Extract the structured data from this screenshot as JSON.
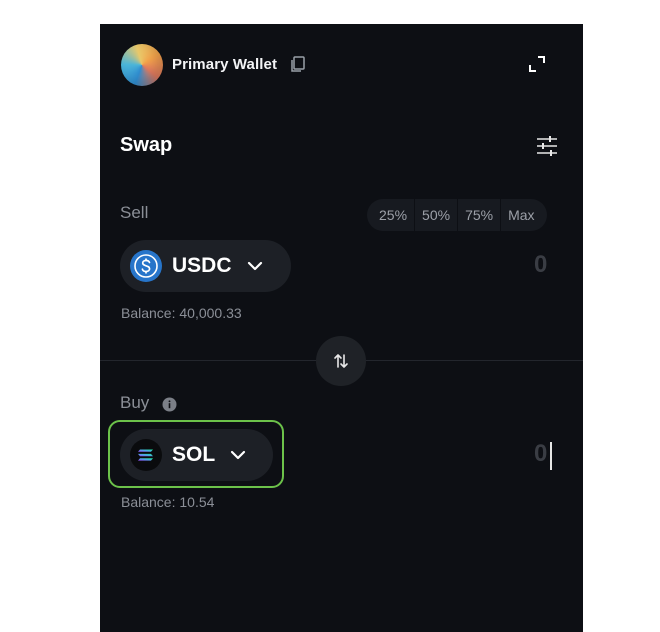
{
  "header": {
    "wallet_name": "Primary Wallet",
    "icons": {
      "avatar": "wallet-avatar",
      "copy": "copy-icon",
      "expand": "expand-icon"
    }
  },
  "swap": {
    "title": "Swap",
    "settings_icon": "settings-sliders-icon"
  },
  "sell": {
    "label": "Sell",
    "percent_options": [
      "25%",
      "50%",
      "75%",
      "Max"
    ],
    "token": {
      "symbol": "USDC",
      "icon": "usdc-icon",
      "color": "#2775ca"
    },
    "amount": "0",
    "balance": "Balance: 40,000.33"
  },
  "buy": {
    "label": "Buy",
    "info_icon": "info-icon",
    "token": {
      "symbol": "SOL",
      "icon": "solana-icon",
      "color": "#9945ff"
    },
    "amount": "0",
    "balance": "Balance: 10.54",
    "highlight_color": "#6cc24a"
  },
  "switch_icon": "swap-direction-icon",
  "colors": {
    "panel_background": "#0d0f14",
    "highlight": "#6cc24a",
    "text_primary": "#ffffff",
    "text_muted": "#8b8f97"
  }
}
